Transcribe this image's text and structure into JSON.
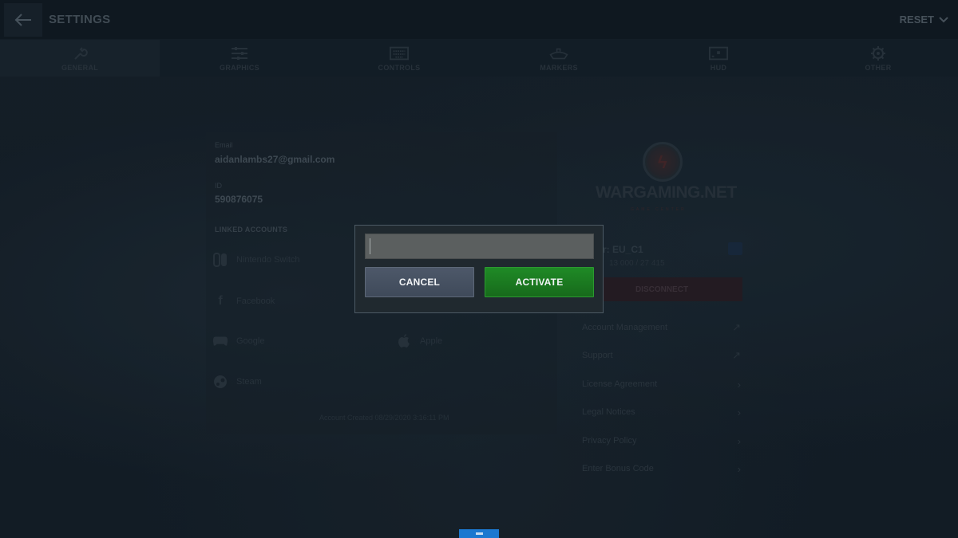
{
  "header": {
    "title": "SETTINGS",
    "back_icon": "arrow-left-icon",
    "reset_label": "RESET",
    "reset_icon": "chevron-down-icon"
  },
  "tabs": [
    {
      "label": "GENERAL",
      "icon": "wrench-icon",
      "active": true
    },
    {
      "label": "GRAPHICS",
      "icon": "sliders-icon",
      "active": false
    },
    {
      "label": "CONTROLS",
      "icon": "keyboard-icon",
      "active": false
    },
    {
      "label": "MARKERS",
      "icon": "ship-icon",
      "active": false
    },
    {
      "label": "HUD",
      "icon": "screen-icon",
      "active": false
    },
    {
      "label": "OTHER",
      "icon": "gear-icon",
      "active": false
    }
  ],
  "account": {
    "email_label": "Email",
    "email_value": "aidanlambs27@gmail.com",
    "id_label": "ID",
    "id_value": "590876075",
    "linked_title": "LINKED ACCOUNTS",
    "linked": [
      {
        "name": "Nintendo Switch",
        "icon": "nintendo-switch-icon"
      },
      {
        "name": "Facebook",
        "icon": "facebook-icon"
      },
      {
        "name": "Google",
        "icon": "gamepad-icon"
      },
      {
        "name": "Apple",
        "icon": "apple-icon"
      },
      {
        "name": "Steam",
        "icon": "steam-icon"
      }
    ],
    "created": "Account Created 08/29/2020 3:16:11 PM"
  },
  "wargaming": {
    "brand": "WARGAMING.NET",
    "sub": "GAME CENTER",
    "server": "r: EU_C1",
    "stats": "13 000 / 27 415",
    "disconnect_label": "DISCONNECT",
    "menu": [
      {
        "label": "Account Management",
        "icon": "external-link-icon"
      },
      {
        "label": "Support",
        "icon": "external-link-icon"
      },
      {
        "label": "License Agreement",
        "icon": "chevron-right-icon"
      },
      {
        "label": "Legal Notices",
        "icon": "chevron-right-icon"
      },
      {
        "label": "Privacy Policy",
        "icon": "chevron-right-icon"
      },
      {
        "label": "Enter Bonus Code",
        "icon": "chevron-right-icon"
      }
    ]
  },
  "modal": {
    "input_value": "",
    "input_placeholder": "",
    "cancel_label": "CANCEL",
    "activate_label": "ACTIVATE",
    "colors": {
      "activate": "#1f8a26",
      "cancel": "#4d5869"
    }
  },
  "accent_color": "#1c78d0"
}
